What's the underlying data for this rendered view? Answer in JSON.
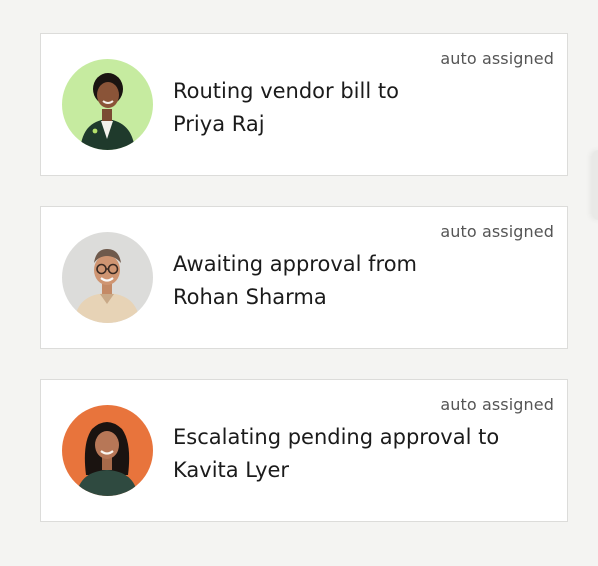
{
  "cards": [
    {
      "badge": "auto assigned",
      "message": "Routing vendor bill to",
      "name": "Priya Raj",
      "avatar_bg": "#c6eba0"
    },
    {
      "badge": "auto assigned",
      "message": "Awaiting approval from",
      "name": "Rohan Sharma",
      "avatar_bg": "#dcdcda"
    },
    {
      "badge": "auto assigned",
      "message": "Escalating pending approval to",
      "name": "Kavita Lyer",
      "avatar_bg": "#e8743c"
    }
  ]
}
